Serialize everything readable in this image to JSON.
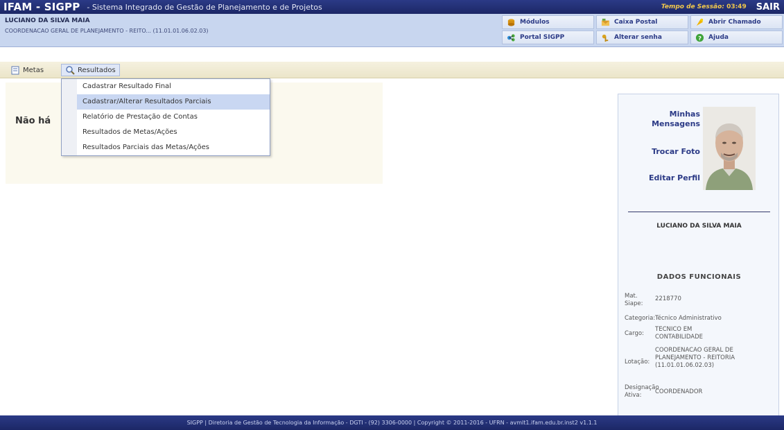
{
  "topbar": {
    "brand": "IFAM - SIGPP",
    "subtitle": "- Sistema Integrado de Gestão de Planejamento e de Projetos",
    "session_label": "Tempo de Sessão:",
    "session_value": "03:49",
    "logout_label": "SAIR"
  },
  "user": {
    "name": "LUCIANO DA SILVA MAIA",
    "department": "COORDENACAO GERAL DE PLANEJAMENTO - REITO... (11.01.01.06.02.03)"
  },
  "shortcuts": [
    {
      "label": "Módulos",
      "icon": "modules-icon"
    },
    {
      "label": "Caixa Postal",
      "icon": "mailbox-icon"
    },
    {
      "label": "Abrir Chamado",
      "icon": "ticket-icon"
    },
    {
      "label": "Portal SIGPP",
      "icon": "portal-icon"
    },
    {
      "label": "Alterar senha",
      "icon": "key-icon"
    },
    {
      "label": "Ajuda",
      "icon": "help-icon"
    }
  ],
  "menu": {
    "metas": "Metas",
    "resultados": "Resultados"
  },
  "dropdown": {
    "items": [
      "Cadastrar Resultado Final",
      "Cadastrar/Alterar Resultados Parciais",
      "Relatório de Prestação de Contas",
      "Resultados de Metas/Ações",
      "Resultados Parciais das Metas/Ações"
    ],
    "highlighted": 1
  },
  "content": {
    "message": "Não há"
  },
  "profile": {
    "links": {
      "messages": "Minhas\nMensagens",
      "change_photo": "Trocar Foto",
      "edit_profile": "Editar Perfil"
    },
    "name": "LUCIANO DA SILVA MAIA",
    "section_title": "DADOS FUNCIONAIS",
    "fields": [
      {
        "label": "Mat. Siape:",
        "value": "2218770"
      },
      {
        "label": "Categoria:",
        "value": "Técnico Administrativo"
      },
      {
        "label": "Cargo:",
        "value": "TECNICO EM CONTABILIDADE"
      },
      {
        "label": "Lotação:",
        "value": "COORDENACAO GERAL DE PLANEJAMENTO - REITORIA (11.01.01.06.02.03)"
      },
      {
        "label": "Designação Ativa:",
        "value": "COORDENADOR"
      }
    ]
  },
  "footer": {
    "text": "SIGPP | Diretoria de Gestão de Tecnologia da Informação - DGTI - (92) 3306-0000 | Copyright © 2011-2016 - UFRN - avmlt1.ifam.edu.br.inst2 v1.1.1"
  },
  "colors": {
    "brand_dark": "#1c2766",
    "user_bar": "#c8d6ef",
    "menu_bar": "#ebe5c9",
    "highlight": "#c9d7f2"
  }
}
